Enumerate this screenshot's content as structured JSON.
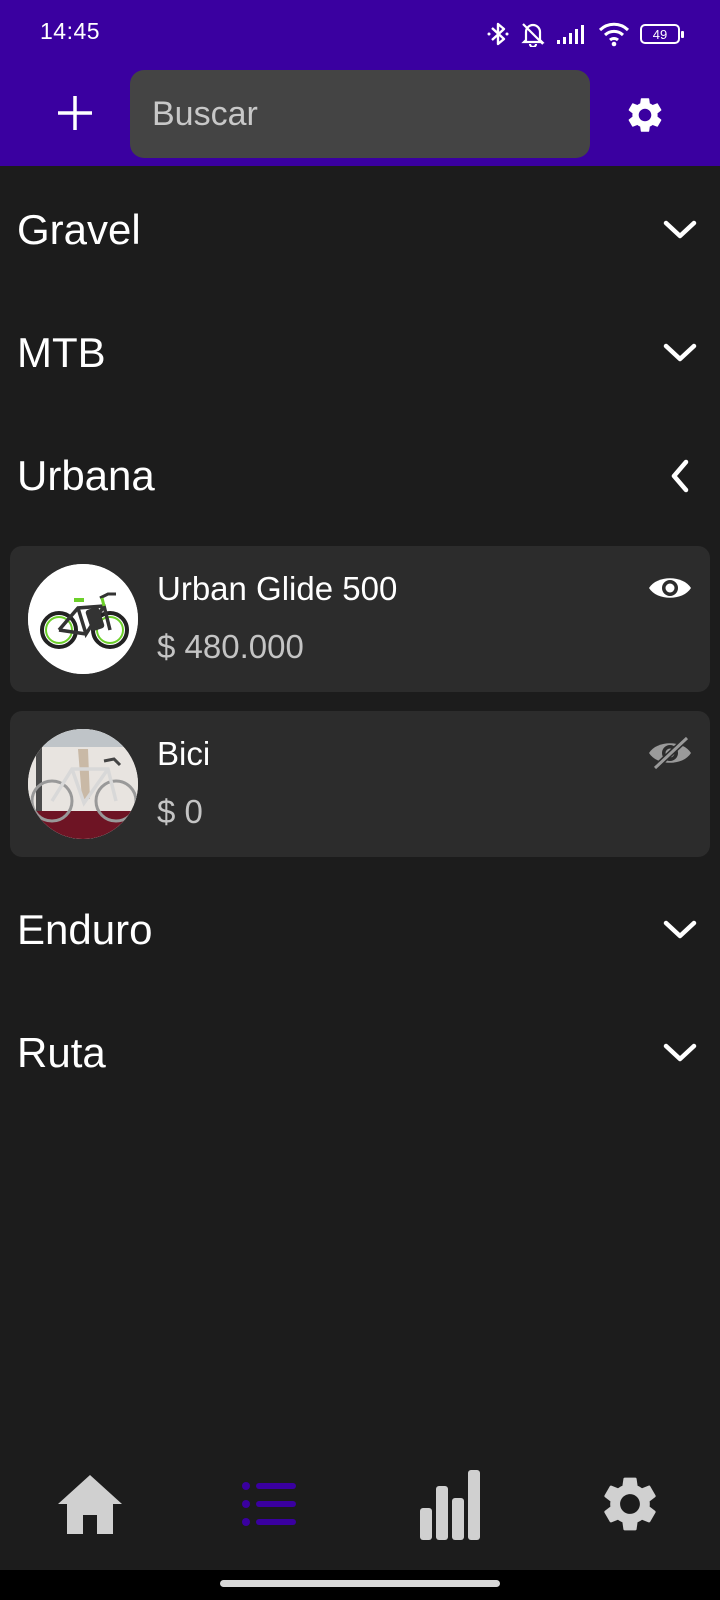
{
  "status_bar": {
    "time": "14:45",
    "battery": "49",
    "icons": [
      "bluetooth-icon",
      "bell-off-icon",
      "signal-icon",
      "wifi-icon",
      "battery-icon"
    ]
  },
  "app_bar": {
    "add_icon": "plus-icon",
    "search_placeholder": "Buscar",
    "search_value": "",
    "settings_icon": "gear-icon"
  },
  "colors": {
    "app_bar": "#3a00a0",
    "background": "#1c1c1c",
    "card": "#2c2c2c",
    "search_field": "#444444",
    "active_nav": "#3a00a0",
    "inactive_nav": "#d0d0d0"
  },
  "categories": [
    {
      "label": "Gravel",
      "expanded": false,
      "chevron": "chevron-down-icon"
    },
    {
      "label": "MTB",
      "expanded": false,
      "chevron": "chevron-down-icon"
    },
    {
      "label": "Urbana",
      "expanded": true,
      "chevron": "chevron-left-icon",
      "products": [
        {
          "name": "Urban Glide 500",
          "price": "$ 480.000",
          "visible": true,
          "visibility_icon": "eye-icon",
          "image": "green-electric-bike"
        },
        {
          "name": "Bici",
          "price": "$ 0",
          "visible": false,
          "visibility_icon": "eye-off-icon",
          "image": "white-road-bike-photo"
        }
      ]
    },
    {
      "label": "Enduro",
      "expanded": false,
      "chevron": "chevron-down-icon"
    },
    {
      "label": "Ruta",
      "expanded": false,
      "chevron": "chevron-down-icon"
    }
  ],
  "bottom_nav": [
    {
      "icon": "home-icon",
      "active": false
    },
    {
      "icon": "list-icon",
      "active": true
    },
    {
      "icon": "bar-chart-icon",
      "active": false
    },
    {
      "icon": "gear-icon",
      "active": false
    }
  ]
}
